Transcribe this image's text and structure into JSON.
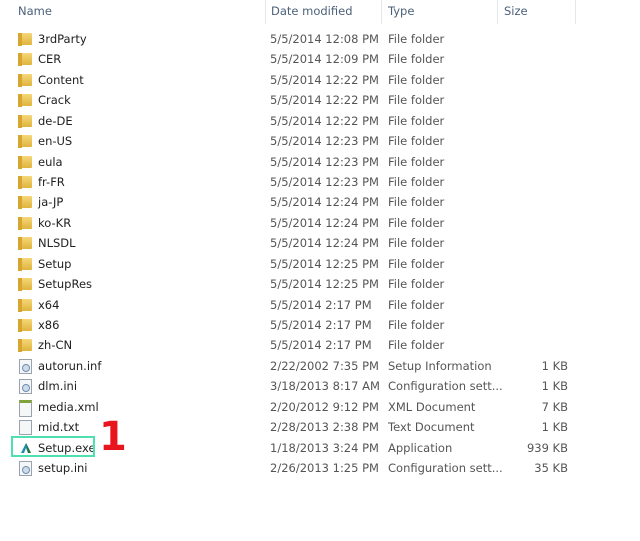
{
  "columns": {
    "name": "Name",
    "date": "Date modified",
    "type": "Type",
    "size": "Size"
  },
  "files": [
    {
      "name": "3rdParty",
      "date": "5/5/2014 12:08 PM",
      "type": "File folder",
      "size": "",
      "icon": "folder"
    },
    {
      "name": "CER",
      "date": "5/5/2014 12:09 PM",
      "type": "File folder",
      "size": "",
      "icon": "folder"
    },
    {
      "name": "Content",
      "date": "5/5/2014 12:22 PM",
      "type": "File folder",
      "size": "",
      "icon": "folder"
    },
    {
      "name": "Crack",
      "date": "5/5/2014 12:22 PM",
      "type": "File folder",
      "size": "",
      "icon": "folder"
    },
    {
      "name": "de-DE",
      "date": "5/5/2014 12:22 PM",
      "type": "File folder",
      "size": "",
      "icon": "folder"
    },
    {
      "name": "en-US",
      "date": "5/5/2014 12:23 PM",
      "type": "File folder",
      "size": "",
      "icon": "folder"
    },
    {
      "name": "eula",
      "date": "5/5/2014 12:23 PM",
      "type": "File folder",
      "size": "",
      "icon": "folder"
    },
    {
      "name": "fr-FR",
      "date": "5/5/2014 12:23 PM",
      "type": "File folder",
      "size": "",
      "icon": "folder"
    },
    {
      "name": "ja-JP",
      "date": "5/5/2014 12:24 PM",
      "type": "File folder",
      "size": "",
      "icon": "folder"
    },
    {
      "name": "ko-KR",
      "date": "5/5/2014 12:24 PM",
      "type": "File folder",
      "size": "",
      "icon": "folder"
    },
    {
      "name": "NLSDL",
      "date": "5/5/2014 12:24 PM",
      "type": "File folder",
      "size": "",
      "icon": "folder"
    },
    {
      "name": "Setup",
      "date": "5/5/2014 12:25 PM",
      "type": "File folder",
      "size": "",
      "icon": "folder"
    },
    {
      "name": "SetupRes",
      "date": "5/5/2014 12:25 PM",
      "type": "File folder",
      "size": "",
      "icon": "folder"
    },
    {
      "name": "x64",
      "date": "5/5/2014 2:17 PM",
      "type": "File folder",
      "size": "",
      "icon": "folder"
    },
    {
      "name": "x86",
      "date": "5/5/2014 2:17 PM",
      "type": "File folder",
      "size": "",
      "icon": "folder"
    },
    {
      "name": "zh-CN",
      "date": "5/5/2014 2:17 PM",
      "type": "File folder",
      "size": "",
      "icon": "folder"
    },
    {
      "name": "autorun.inf",
      "date": "2/22/2002 7:35 PM",
      "type": "Setup Information",
      "size": "1 KB",
      "icon": "config"
    },
    {
      "name": "dlm.ini",
      "date": "3/18/2013 8:17 AM",
      "type": "Configuration sett...",
      "size": "1 KB",
      "icon": "config"
    },
    {
      "name": "media.xml",
      "date": "2/20/2012 9:12 PM",
      "type": "XML Document",
      "size": "7 KB",
      "icon": "xml"
    },
    {
      "name": "mid.txt",
      "date": "2/28/2013 2:38 PM",
      "type": "Text Document",
      "size": "1 KB",
      "icon": "text"
    },
    {
      "name": "Setup.exe",
      "date": "1/18/2013 3:24 PM",
      "type": "Application",
      "size": "939 KB",
      "icon": "autodesk-app"
    },
    {
      "name": "setup.ini",
      "date": "2/26/2013 1:25 PM",
      "type": "Configuration sett...",
      "size": "35 KB",
      "icon": "config"
    }
  ],
  "annotation": {
    "step": "1",
    "highlight_color": "#4fe0b0",
    "number_color": "#e8141e"
  }
}
